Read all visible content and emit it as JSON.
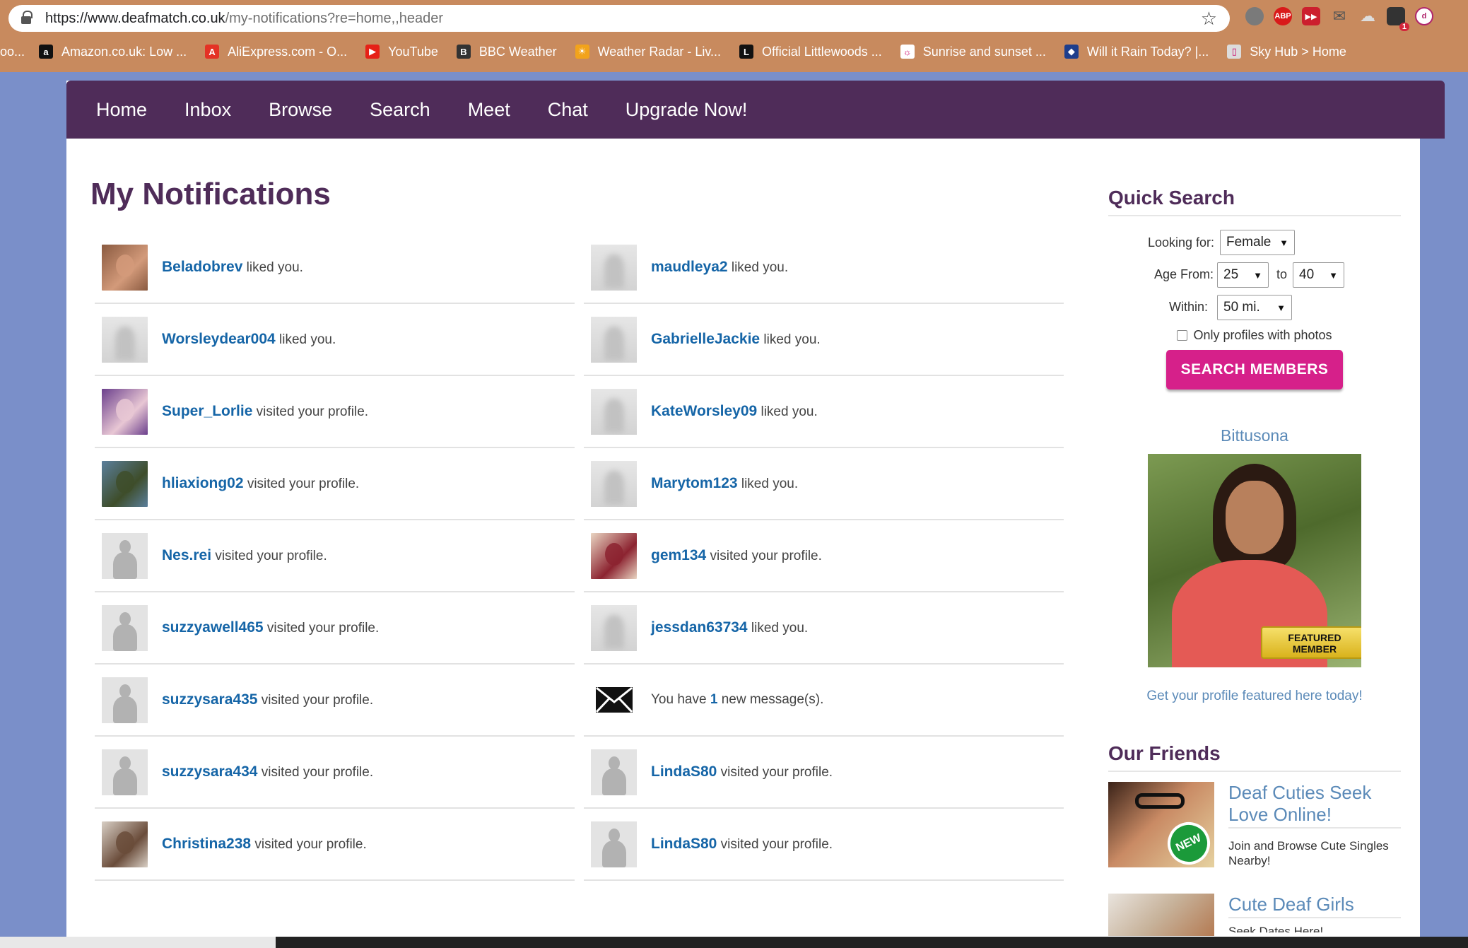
{
  "browser": {
    "url_host": "https://www.deafmatch.co.uk",
    "url_path": "/my-notifications?re=home,,header",
    "bookmarks": [
      {
        "label": "Amazon.co.uk: Low ...",
        "icon": "amazon-icon",
        "color": "#111111",
        "glyph": "a"
      },
      {
        "label": "AliExpress.com - O...",
        "icon": "aliexpress-icon",
        "color": "#e43225",
        "glyph": "A"
      },
      {
        "label": "YouTube",
        "icon": "youtube-icon",
        "color": "#e62117",
        "glyph": "▶"
      },
      {
        "label": "BBC Weather",
        "icon": "bbc-icon",
        "color": "#333333",
        "glyph": "B"
      },
      {
        "label": "Weather Radar - Liv...",
        "icon": "weather-radar-icon",
        "color": "#f2a31b",
        "glyph": "☀"
      },
      {
        "label": "Official Littlewoods ...",
        "icon": "littlewoods-icon",
        "color": "#111111",
        "glyph": "L"
      },
      {
        "label": "Sunrise and sunset ...",
        "icon": "sunrise-icon",
        "color": "#ffffff",
        "glyph": "☼"
      },
      {
        "label": "Will it Rain Today? |...",
        "icon": "rain-icon",
        "color": "#1e3e8c",
        "glyph": "◆"
      },
      {
        "label": "Sky Hub > Home",
        "icon": "page-icon",
        "color": "#dcdcdc",
        "glyph": "▯"
      }
    ],
    "extension_badge": "1"
  },
  "nav": {
    "items": [
      "Home",
      "Inbox",
      "Browse",
      "Search",
      "Meet",
      "Chat",
      "Upgrade Now!"
    ]
  },
  "page": {
    "title": "My Notifications"
  },
  "notifications": {
    "left": [
      {
        "user": "Beladobrev",
        "action": "liked you.",
        "thumb": "photo",
        "colors": [
          "#8a5a40",
          "#d39a7a"
        ]
      },
      {
        "user": "Worsleydear004",
        "action": "liked you.",
        "thumb": "blur"
      },
      {
        "user": "Super_Lorlie",
        "action": "visited your profile.",
        "thumb": "photo",
        "colors": [
          "#6b3f8c",
          "#e8c7d4"
        ]
      },
      {
        "user": "hliaxiong02",
        "action": "visited your profile.",
        "thumb": "photo",
        "colors": [
          "#5b7f9c",
          "#3e4d2a"
        ]
      },
      {
        "user": "Nes.rei",
        "action": "visited your profile.",
        "thumb": "silhouette"
      },
      {
        "user": "suzzyawell465",
        "action": "visited your profile.",
        "thumb": "silhouette"
      },
      {
        "user": "suzzysara435",
        "action": "visited your profile.",
        "thumb": "silhouette"
      },
      {
        "user": "suzzysara434",
        "action": "visited your profile.",
        "thumb": "silhouette"
      },
      {
        "user": "Christina238",
        "action": "visited your profile.",
        "thumb": "photo",
        "colors": [
          "#d8cfc5",
          "#6a4c3a"
        ]
      }
    ],
    "right": [
      {
        "user": "maudleya2",
        "action": "liked you.",
        "thumb": "blur"
      },
      {
        "user": "GabrielleJackie",
        "action": "liked you.",
        "thumb": "blur"
      },
      {
        "user": "KateWorsley09",
        "action": "liked you.",
        "thumb": "blur"
      },
      {
        "user": "Marytom123",
        "action": "liked you.",
        "thumb": "blur"
      },
      {
        "user": "gem134",
        "action": "visited your profile.",
        "thumb": "photo",
        "colors": [
          "#e9d5c2",
          "#8c2330"
        ]
      },
      {
        "user": "jessdan63734",
        "action": "liked you.",
        "thumb": "blur"
      },
      {
        "message_prefix": "You have",
        "message_count": "1",
        "message_suffix": "new message(s).",
        "thumb": "mail"
      },
      {
        "user": "LindaS80",
        "action": "visited your profile.",
        "thumb": "silhouette"
      },
      {
        "user": "LindaS80",
        "action": "visited your profile.",
        "thumb": "silhouette"
      }
    ]
  },
  "quick_search": {
    "heading": "Quick Search",
    "looking_for_label": "Looking for:",
    "looking_for_value": "Female",
    "age_from_label": "Age From:",
    "age_from_value": "25",
    "age_to_label": "to",
    "age_to_value": "40",
    "within_label": "Within:",
    "within_value": "50 mi.",
    "photos_only_label": "Only profiles with photos",
    "photos_only_checked": false,
    "button_label": "SEARCH MEMBERS"
  },
  "featured": {
    "name": "Bittusona",
    "badge_line1": "FEATURED",
    "badge_line2": "MEMBER",
    "link_text": "Get your profile featured here today!"
  },
  "friends": {
    "heading": "Our Friends",
    "items": [
      {
        "title": "Deaf Cuties Seek Love Online!",
        "description": "Join and Browse Cute Singles Nearby!",
        "badge": "NEW"
      },
      {
        "title": "Cute Deaf Girls",
        "description": "Seek Dates Here!"
      }
    ]
  },
  "colors": {
    "nav_bg": "#4f2c59",
    "title": "#4f2c59",
    "link": "#1565a7",
    "button": "#d6208a",
    "side_link": "#5b8ab8"
  }
}
